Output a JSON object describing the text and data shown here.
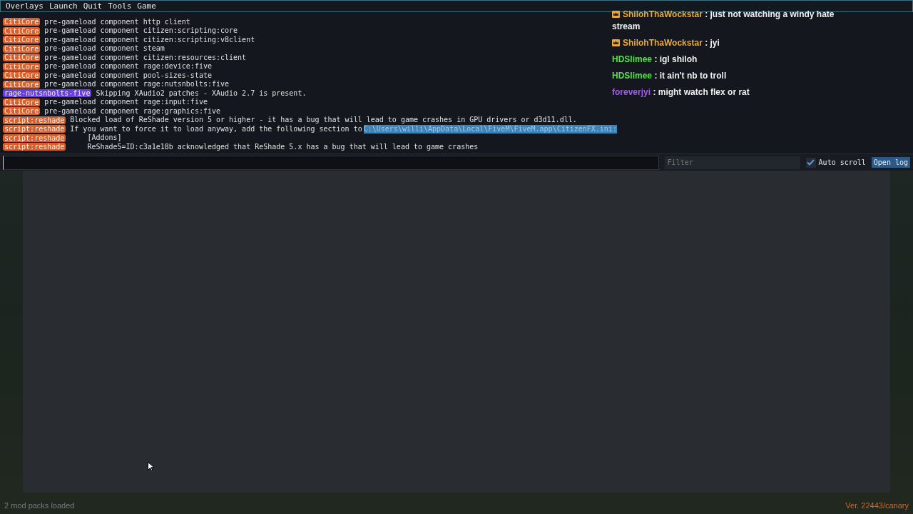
{
  "menu": [
    "Overlays",
    "Launch",
    "Quit",
    "Tools",
    "Game"
  ],
  "log": [
    {
      "tag": "CitiCore",
      "color": "#d8602c",
      "text": "pre-gameload component http client"
    },
    {
      "tag": "CitiCore",
      "color": "#d8602c",
      "text": "pre-gameload component citizen:scripting:core"
    },
    {
      "tag": "CitiCore",
      "color": "#d8602c",
      "text": "pre-gameload component citizen:scripting:v8client"
    },
    {
      "tag": "CitiCore",
      "color": "#d8602c",
      "text": "pre-gameload component steam"
    },
    {
      "tag": "CitiCore",
      "color": "#d8602c",
      "text": "pre-gameload component citizen:resources:client"
    },
    {
      "tag": "CitiCore",
      "color": "#d8602c",
      "text": "pre-gameload component rage:device:five"
    },
    {
      "tag": "CitiCore",
      "color": "#d8602c",
      "text": "pre-gameload component pool-sizes-state"
    },
    {
      "tag": "CitiCore",
      "color": "#d8602c",
      "text": "pre-gameload component rage:nutsnbolts:five"
    },
    {
      "tag": "rage-nutsnbolts-five",
      "color": "#6a3fe0",
      "text": "Skipping XAudio2 patches - XAudio 2.7 is present."
    },
    {
      "tag": "CitiCore",
      "color": "#d8602c",
      "text": "pre-gameload component rage:input:five"
    },
    {
      "tag": "CitiCore",
      "color": "#d8602c",
      "text": "pre-gameload component rage:graphics:five"
    },
    {
      "tag": "script:reshade",
      "color": "#d8602c",
      "text": "Blocked load of ReShade version 5 or higher - it has a bug that will lead to game crashes in GPU drivers or d3d11.dll."
    },
    {
      "tag": "script:reshade",
      "color": "#d8602c",
      "text": "If you want to force it to load anyway, add the following section to",
      "selection": "C:\\Users\\willi\\AppData\\Local\\FiveM\\FiveM.app\\CitizenFX.ini:"
    },
    {
      "tag": "script:reshade",
      "color": "#d8602c",
      "text": "    [Addons]"
    },
    {
      "tag": "script:reshade",
      "color": "#d8602c",
      "text": "    ReShade5=ID:c3a1e18b acknowledged that ReShade 5.x has a bug that will lead to game crashes"
    }
  ],
  "chat": [
    {
      "user": "ShilohThaWockstar",
      "color": "#e8a93a",
      "badge": true,
      "text": ": just not watching a windy hate stream"
    },
    {
      "user": "ShilohThaWockstar",
      "color": "#e8a93a",
      "badge": true,
      "text": ": jyi"
    },
    {
      "user": "HDSlimee",
      "color": "#57e04a",
      "badge": false,
      "text": ": igl shiloh"
    },
    {
      "user": "HDSlimee",
      "color": "#57e04a",
      "badge": false,
      "text": ": it ain't nb to troll"
    },
    {
      "user": "foreverjyi",
      "color": "#a35ee8",
      "badge": false,
      "text": ": might watch flex or rat"
    }
  ],
  "console": {
    "filter": {
      "placeholder": "Filter"
    },
    "auto_scroll": {
      "label": "Auto scroll",
      "checked": true
    },
    "open_log": "Open log"
  },
  "status": {
    "mods": "2 mod packs loaded",
    "version": "Ver. 22443/canary"
  }
}
